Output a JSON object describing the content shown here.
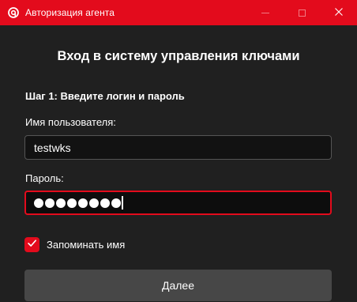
{
  "window": {
    "title": "Авторизация агента",
    "accent_color": "#e30b1c",
    "icons": [
      "app-logo-icon",
      "minimize-icon",
      "maximize-icon",
      "close-icon"
    ]
  },
  "form": {
    "heading": "Вход в систему управления ключами",
    "step_title": "Шаг 1: Введите логин и пароль",
    "username_label": "Имя пользователя:",
    "username_value": "testwks",
    "password_label": "Пароль:",
    "password_masked_length": 8,
    "remember_label": "Запоминать имя",
    "remember_checked": true,
    "next_button": "Далее"
  }
}
